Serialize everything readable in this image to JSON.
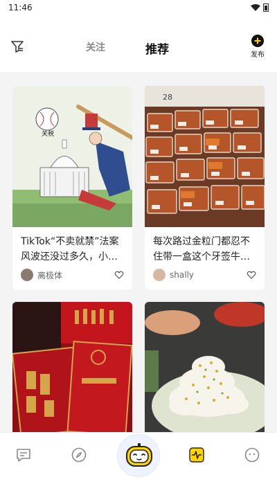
{
  "status_bar": {
    "time": "11:46"
  },
  "header": {
    "tabs": [
      {
        "label": "关注",
        "active": false
      },
      {
        "label": "推荐",
        "active": true
      }
    ],
    "publish_label": "发布",
    "accent": "#ffd400"
  },
  "feed": {
    "cards": [
      {
        "title": "TikTok“不卖就禁”法案风波还没过多久，小…",
        "author": "离极体",
        "image": "political-cartoon",
        "image_text": "关税"
      },
      {
        "title": "每次路过金粒门都忍不住带一盒这个牙签牛…",
        "author": "shally",
        "image": "supermarket-meat-trays",
        "image_text": "28"
      },
      {
        "title": "",
        "author": "",
        "image": "red-envelopes",
        "image_text": ""
      },
      {
        "title": "",
        "author": "",
        "image": "hotpot-dish",
        "image_text": ""
      }
    ]
  },
  "tabbar": {
    "items": [
      {
        "label": "",
        "icon": "chat-icon"
      },
      {
        "label": "",
        "icon": "compass-icon"
      },
      {
        "label": "",
        "icon": "robot-icon"
      },
      {
        "label": "",
        "icon": "pulse-icon",
        "active": true
      },
      {
        "label": "",
        "icon": "smile-icon"
      }
    ]
  }
}
